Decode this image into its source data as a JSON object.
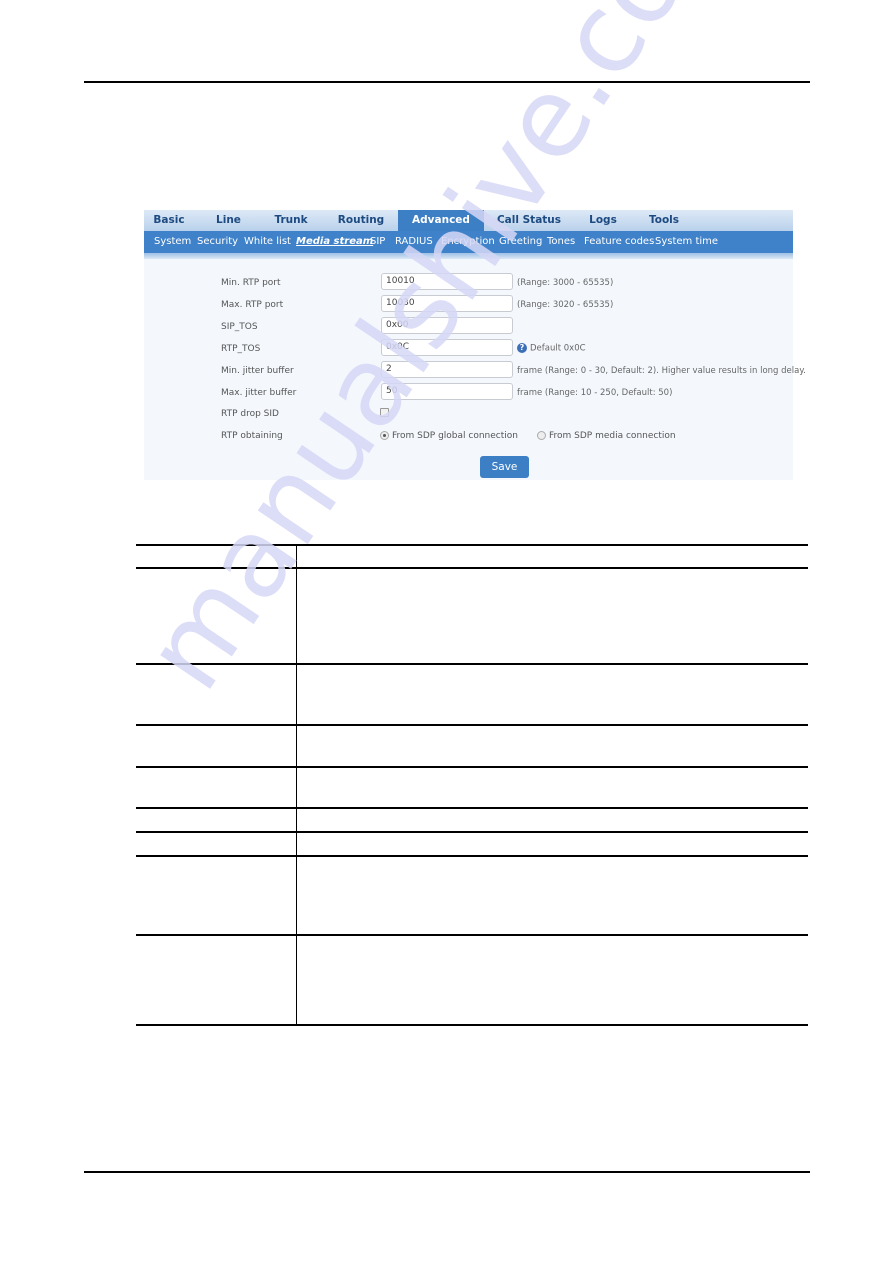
{
  "ui": {
    "main_tabs": [
      {
        "label": "Basic",
        "active": false
      },
      {
        "label": "Line",
        "active": false
      },
      {
        "label": "Trunk",
        "active": false
      },
      {
        "label": "Routing",
        "active": false
      },
      {
        "label": "Advanced",
        "active": true
      },
      {
        "label": "Call Status",
        "active": false
      },
      {
        "label": "Logs",
        "active": false
      },
      {
        "label": "Tools",
        "active": false
      }
    ],
    "sub_tabs": [
      {
        "label": "System",
        "active": false
      },
      {
        "label": "Security",
        "active": false
      },
      {
        "label": "White list",
        "active": false
      },
      {
        "label": "Media stream",
        "active": true
      },
      {
        "label": "SIP",
        "active": false
      },
      {
        "label": "RADIUS",
        "active": false
      },
      {
        "label": "Encryption",
        "active": false
      },
      {
        "label": "Greeting",
        "active": false
      },
      {
        "label": "Tones",
        "active": false
      },
      {
        "label": "Feature codes",
        "active": false
      },
      {
        "label": "System time",
        "active": false
      }
    ],
    "fields": [
      {
        "label": "Min. RTP port",
        "value": "10010",
        "hint": "(Range: 3000 - 65535)"
      },
      {
        "label": "Max. RTP port",
        "value": "10030",
        "hint": "(Range: 3020 - 65535)"
      },
      {
        "label": "SIP_TOS",
        "value": "0x00",
        "hint": ""
      },
      {
        "label": "RTP_TOS",
        "value": "0x0C",
        "hint": "Default 0x0C",
        "help_icon": "question-circle-icon"
      },
      {
        "label": "Min. jitter buffer",
        "value": "2",
        "hint": "frame (Range: 0 - 30, Default: 2). Higher value results in long delay."
      },
      {
        "label": "Max. jitter buffer",
        "value": "50",
        "hint": "frame (Range: 10 - 250, Default: 50)"
      }
    ],
    "rtp_drop_sid": {
      "label": "RTP drop SID",
      "checked": false
    },
    "rtp_obtaining": {
      "label": "RTP obtaining",
      "options": [
        {
          "label": "From SDP global connection",
          "selected": true
        },
        {
          "label": "From SDP media connection",
          "selected": false
        }
      ]
    },
    "save_label": "Save"
  },
  "table": {
    "rows": 9,
    "columns": 2
  },
  "watermark": "manualshive.com"
}
